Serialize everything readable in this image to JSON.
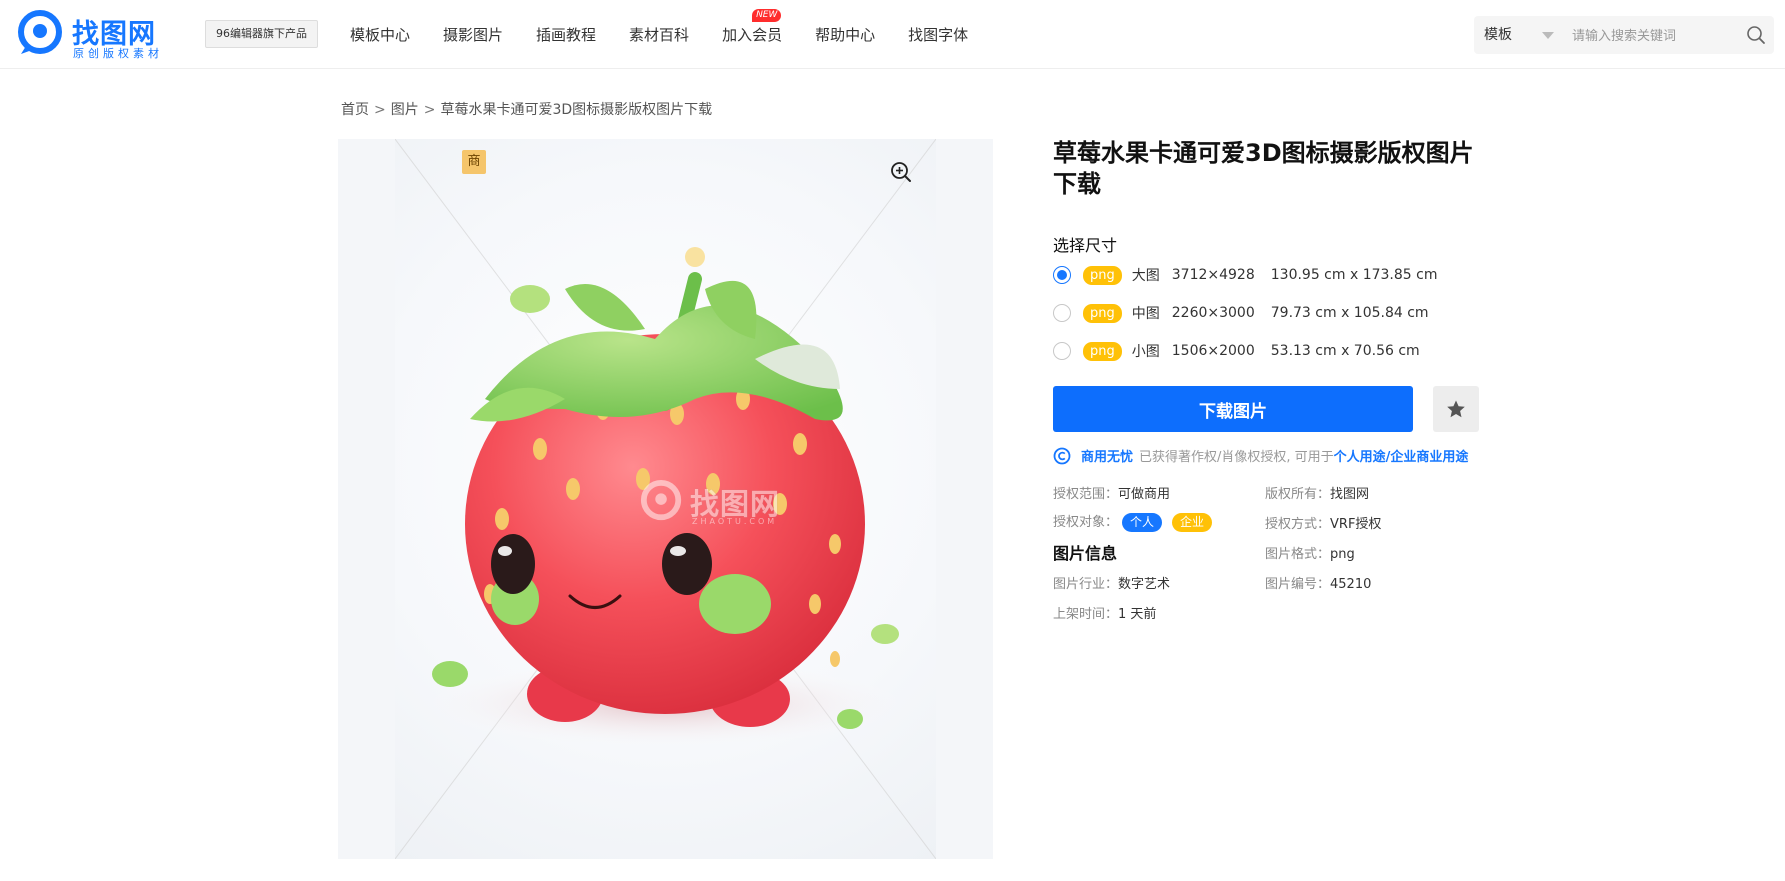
{
  "header": {
    "logo_title": "找图网",
    "logo_sub": "原创版权素材",
    "product_tag": "96编辑器旗下产品",
    "nav": [
      {
        "label": "模板中心"
      },
      {
        "label": "摄影图片"
      },
      {
        "label": "插画教程"
      },
      {
        "label": "素材百科"
      },
      {
        "label": "加入会员",
        "badge": "NEW"
      },
      {
        "label": "帮助中心"
      },
      {
        "label": "找图字体"
      }
    ],
    "search": {
      "type": "模板",
      "placeholder": "请输入搜索关键词"
    }
  },
  "breadcrumb": {
    "home": "首页",
    "category": "图片",
    "current": "草莓水果卡通可爱3D图标摄影版权图片下载",
    "separator": ">"
  },
  "preview": {
    "commercial_badge": "商",
    "watermark": "找图网",
    "watermark_sub": "ZHAOTU.COM"
  },
  "detail": {
    "title": "草莓水果卡通可爱3D图标摄影版权图片下载",
    "size_label": "选择尺寸",
    "sizes": [
      {
        "format": "png",
        "name": "大图",
        "pixels": "3712×4928",
        "cm": "130.95 cm x 173.85 cm",
        "selected": true
      },
      {
        "format": "png",
        "name": "中图",
        "pixels": "2260×3000",
        "cm": "79.73 cm x 105.84 cm",
        "selected": false
      },
      {
        "format": "png",
        "name": "小图",
        "pixels": "1506×2000",
        "cm": "53.13 cm x 70.56 cm",
        "selected": false
      }
    ],
    "download_label": "下载图片",
    "license": {
      "strong": "商用无忧",
      "grey": "已获得著作权/肖像权授权, 可用于",
      "blue": "个人用途/企业商业用途"
    },
    "info": {
      "scope_k": "授权范围：",
      "scope_v": "可做商用",
      "owner_k": "版权所有：",
      "owner_v": "找图网",
      "target_k": "授权对象：",
      "target_personal": "个人",
      "target_enterprise": "企业",
      "method_k": "授权方式：",
      "method_v": "VRF授权",
      "section_title": "图片信息",
      "format_k": "图片格式：",
      "format_v": "png",
      "industry_k": "图片行业：",
      "industry_v": "数字艺术",
      "id_k": "图片编号：",
      "id_v": "45210",
      "time_k": "上架时间：",
      "time_v": "1 天前"
    }
  },
  "colors": {
    "brand": "#1677ff",
    "button": "#0d6efd",
    "format_badge": "#ffc107",
    "new_badge": "#ff2d2d"
  }
}
